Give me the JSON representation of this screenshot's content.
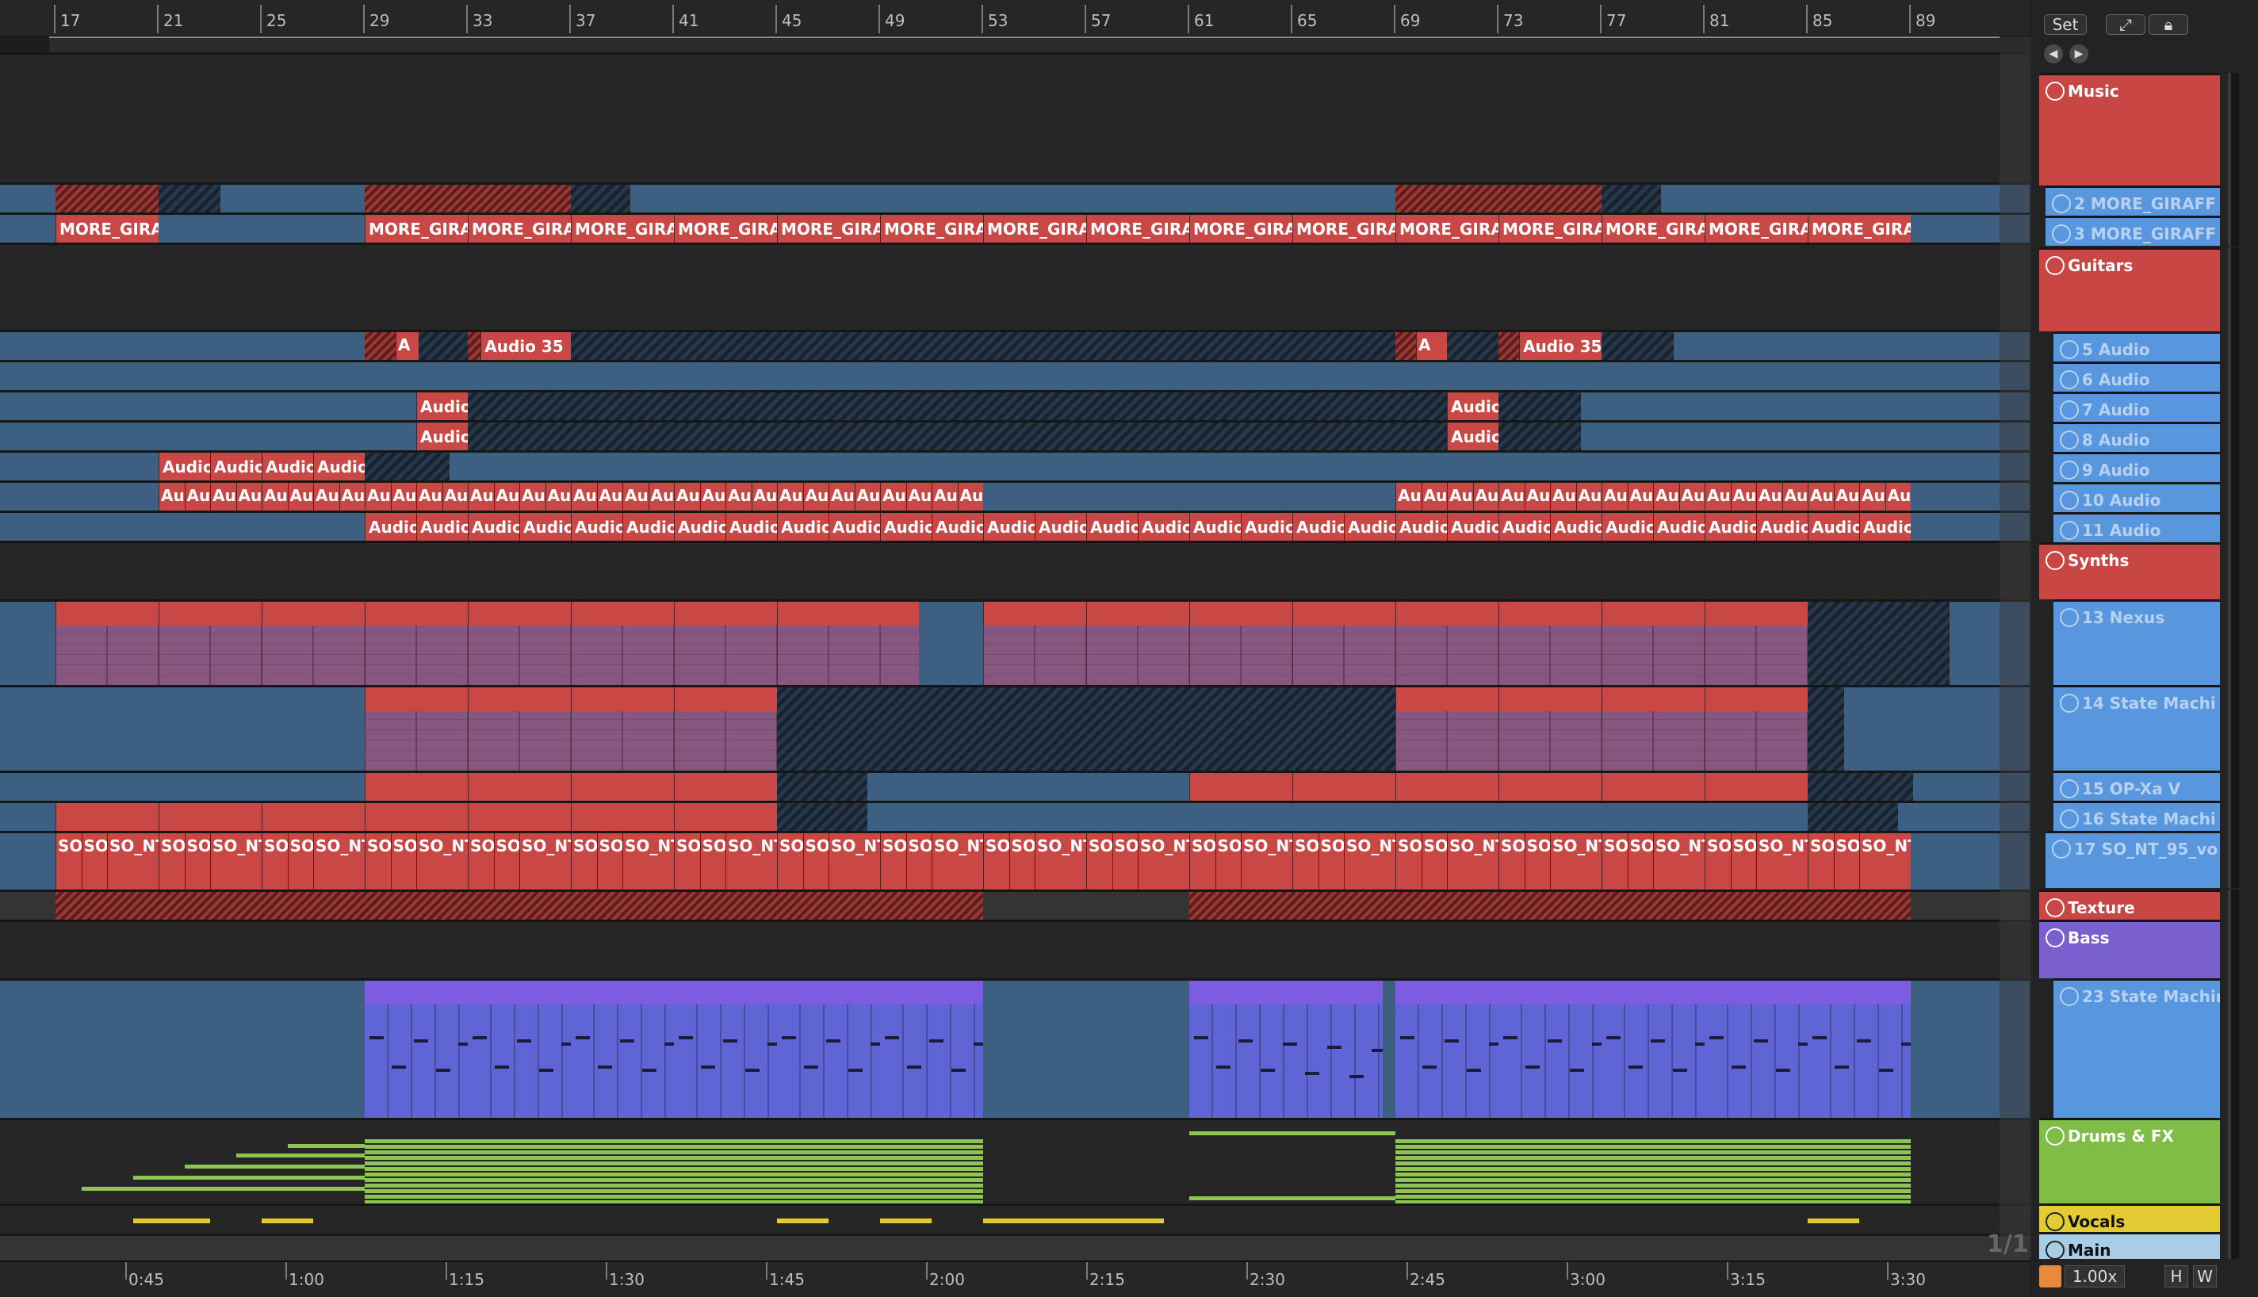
{
  "ruler": {
    "bars": [
      "17",
      "21",
      "25",
      "29",
      "33",
      "37",
      "41",
      "45",
      "49",
      "53",
      "57",
      "61",
      "65",
      "69",
      "73",
      "77",
      "81",
      "85",
      "89"
    ]
  },
  "timeline": {
    "times": [
      "0:45",
      "1:00",
      "1:15",
      "1:30",
      "1:45",
      "2:00",
      "2:15",
      "2:30",
      "2:45",
      "3:00",
      "3:15",
      "3:30"
    ]
  },
  "toolbar": {
    "set_label": "Set",
    "expand_icon": "expand-icon",
    "lock_icon": "lock-icon",
    "back_icon": "arrow-left-icon",
    "forward_icon": "arrow-right-icon"
  },
  "page_indicator": "1/1",
  "footer": {
    "zoom": "1.00x",
    "h_label": "H",
    "w_label": "W"
  },
  "clips": {
    "giraff_short": "MORE_GIRAF",
    "audio35": "Audio 35",
    "audio": "Audio",
    "au": "Au",
    "a": "A",
    "so": "SO",
    "so_nt": "SO_NT"
  },
  "tracks": [
    {
      "id": "music",
      "name": "Music",
      "kind": "group",
      "color": "#c84745"
    },
    {
      "id": "t2",
      "name": "2 MORE_GIRAFF",
      "kind": "child"
    },
    {
      "id": "t3",
      "name": "3 MORE_GIRAFF",
      "kind": "child"
    },
    {
      "id": "guitars",
      "name": "Guitars",
      "kind": "group"
    },
    {
      "id": "t5",
      "name": "5 Audio",
      "kind": "child"
    },
    {
      "id": "t6",
      "name": "6 Audio",
      "kind": "child"
    },
    {
      "id": "t7",
      "name": "7 Audio",
      "kind": "child"
    },
    {
      "id": "t8",
      "name": "8 Audio",
      "kind": "child"
    },
    {
      "id": "t9",
      "name": "9 Audio",
      "kind": "child"
    },
    {
      "id": "t10",
      "name": "10 Audio",
      "kind": "child"
    },
    {
      "id": "t11",
      "name": "11 Audio",
      "kind": "child"
    },
    {
      "id": "synths",
      "name": "Synths",
      "kind": "group"
    },
    {
      "id": "t13",
      "name": "13 Nexus",
      "kind": "child"
    },
    {
      "id": "t14",
      "name": "14 State Machi",
      "kind": "child"
    },
    {
      "id": "t15",
      "name": "15 OP-Xa V",
      "kind": "child"
    },
    {
      "id": "t16",
      "name": "16 State Machi",
      "kind": "child"
    },
    {
      "id": "t17",
      "name": "17 SO_NT_95_vo",
      "kind": "child"
    },
    {
      "id": "texture",
      "name": "Texture",
      "kind": "group"
    },
    {
      "id": "bass",
      "name": "Bass",
      "kind": "group",
      "color": "#7a5fcf"
    },
    {
      "id": "t23",
      "name": "23 State Machin",
      "kind": "child"
    },
    {
      "id": "drums",
      "name": "Drums & FX",
      "kind": "group",
      "color": "#7fbd47"
    },
    {
      "id": "vocals",
      "name": "Vocals",
      "kind": "group",
      "color": "#e2cb33"
    },
    {
      "id": "main",
      "name": "Main",
      "kind": "main",
      "color": "#a9cde6"
    }
  ]
}
